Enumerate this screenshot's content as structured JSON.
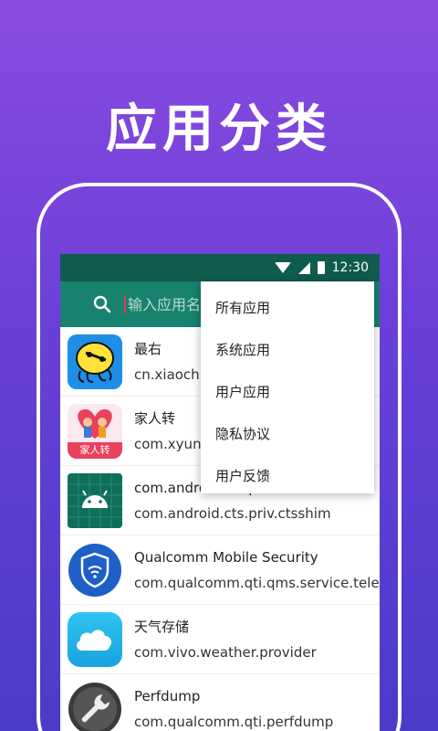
{
  "promo": {
    "title": "应用分类"
  },
  "status_bar": {
    "time": "12:30"
  },
  "search": {
    "placeholder": "输入应用名"
  },
  "menu": {
    "items": [
      {
        "label": "所有应用"
      },
      {
        "label": "系统应用"
      },
      {
        "label": "用户应用"
      },
      {
        "label": "隐私协议"
      },
      {
        "label": "用户反馈"
      }
    ]
  },
  "apps": [
    {
      "name": "最右",
      "package": "cn.xiaochu",
      "icon": "zuiyou-icon"
    },
    {
      "name": "家人转",
      "package": "com.xyun.",
      "icon": "jiarenzhuan-icon",
      "icon_text": "家人转"
    },
    {
      "name": "com.android.cts.priv.ctsshim",
      "package": "com.android.cts.priv.ctsshim",
      "icon": "android-icon"
    },
    {
      "name": "Qualcomm Mobile Security",
      "package": "com.qualcomm.qti.qms.service.telem",
      "icon": "shield-wifi-icon"
    },
    {
      "name": "天气存储",
      "package": "com.vivo.weather.provider",
      "icon": "cloud-icon"
    },
    {
      "name": "Perfdump",
      "package": "com.qualcomm.qti.perfdump",
      "icon": "wrench-icon"
    }
  ],
  "colors": {
    "status_bar": "#0f5c4e",
    "app_bar": "#17826d",
    "background_top": "#8a4be0",
    "background_bottom": "#4a3bc8"
  }
}
